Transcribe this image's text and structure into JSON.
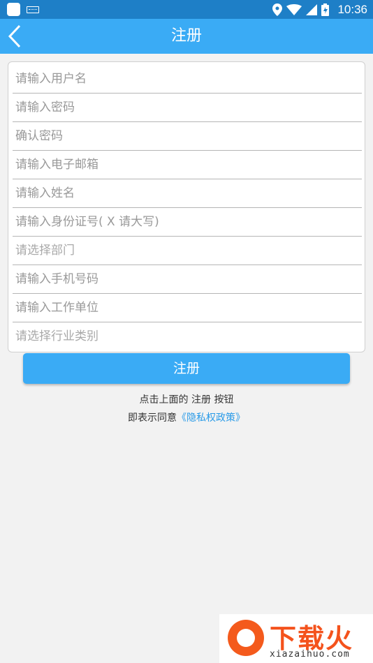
{
  "status_bar": {
    "time": "10:36",
    "icons": [
      "app-icon",
      "keyboard-icon",
      "location-icon",
      "wifi-icon",
      "signal-icon",
      "battery-icon"
    ]
  },
  "header": {
    "title": "注册",
    "back_icon": "chevron-left-icon",
    "background": "#3aabf5"
  },
  "form": {
    "fields": [
      {
        "placeholder": "请输入用户名",
        "kind": "input"
      },
      {
        "placeholder": "请输入密码",
        "kind": "input"
      },
      {
        "placeholder": "确认密码",
        "kind": "input"
      },
      {
        "placeholder": "请输入电子邮箱",
        "kind": "input"
      },
      {
        "placeholder": "请输入姓名",
        "kind": "input"
      },
      {
        "placeholder": "请输入身份证号( X 请大写)",
        "kind": "input"
      },
      {
        "placeholder": "请选择部门",
        "kind": "select"
      },
      {
        "placeholder": "请输入手机号码",
        "kind": "input"
      },
      {
        "placeholder": "请输入工作单位",
        "kind": "input"
      },
      {
        "placeholder": "请选择行业类别",
        "kind": "select"
      }
    ]
  },
  "submit": {
    "label": "注册"
  },
  "agreement": {
    "line1": "点击上面的 注册 按钮",
    "line2_prefix": "即表示同意",
    "privacy_link": "《隐私权政策》"
  },
  "watermark": {
    "brand": "下载火",
    "domain": "xiazaihuo.com"
  },
  "colors": {
    "accent": "#3aabf5",
    "status_bar": "#1e7fc7",
    "link": "#2a9be8",
    "background": "#f2f2f2"
  }
}
